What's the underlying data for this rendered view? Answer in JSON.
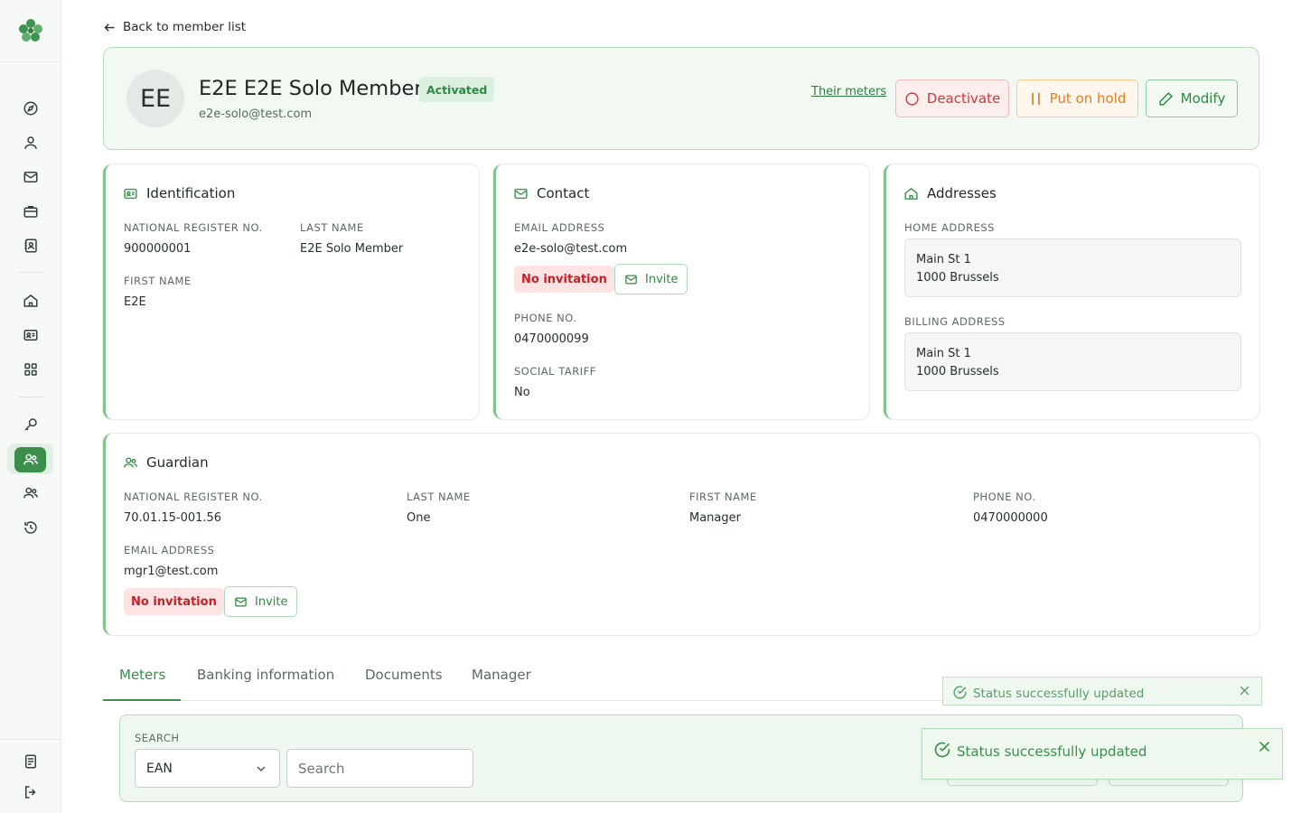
{
  "navigation": {
    "back_label": "Back to member list"
  },
  "member": {
    "initials": "EE",
    "name": "E2E E2E Solo Member",
    "status_badge": "Activated",
    "email": "e2e-solo@test.com"
  },
  "header_actions": {
    "their_meters": "Their meters",
    "deactivate": "Deactivate",
    "put_on_hold": "Put on hold",
    "modify": "Modify"
  },
  "identification": {
    "title": "Identification",
    "national_register_label": "NATIONAL REGISTER NO.",
    "national_register_value": "900000001",
    "last_name_label": "LAST NAME",
    "last_name_value": "E2E Solo Member",
    "first_name_label": "FIRST NAME",
    "first_name_value": "E2E"
  },
  "contact": {
    "title": "Contact",
    "email_label": "EMAIL ADDRESS",
    "email_value": "e2e-solo@test.com",
    "invitation_status": "No invitation",
    "invite_button": "Invite",
    "phone_label": "PHONE NO.",
    "phone_value": "0470000099",
    "social_tariff_label": "SOCIAL TARIFF",
    "social_tariff_value": "No"
  },
  "addresses": {
    "title": "Addresses",
    "home_label": "HOME ADDRESS",
    "home_line1": "Main St 1",
    "home_line2": "1000 Brussels",
    "billing_label": "BILLING ADDRESS",
    "billing_line1": "Main St 1",
    "billing_line2": "1000 Brussels"
  },
  "guardian": {
    "title": "Guardian",
    "national_register_label": "NATIONAL REGISTER NO.",
    "national_register_value": "70.01.15-001.56",
    "last_name_label": "LAST NAME",
    "last_name_value": "One",
    "first_name_label": "FIRST NAME",
    "first_name_value": "Manager",
    "phone_label": "PHONE NO.",
    "phone_value": "0470000000",
    "email_label": "EMAIL ADDRESS",
    "email_value": "mgr1@test.com",
    "invitation_status": "No invitation",
    "invite_button": "Invite"
  },
  "tabs": {
    "items": [
      {
        "label": "Meters",
        "active": true
      },
      {
        "label": "Banking information",
        "active": false
      },
      {
        "label": "Documents",
        "active": false
      },
      {
        "label": "Manager",
        "active": false
      }
    ]
  },
  "search": {
    "label": "SEARCH",
    "field_selected": "EAN",
    "placeholder": "Search"
  },
  "toasts": [
    {
      "message": "Status successfully updated"
    },
    {
      "message": "Status successfully updated"
    }
  ],
  "sidebar": {
    "icons": [
      "compass-icon",
      "user-icon",
      "mail-icon",
      "briefcase-icon",
      "contact-book-icon",
      "home-icon",
      "id-card-icon",
      "grid-icon",
      "key-icon",
      "members-icon",
      "group-icon",
      "history-icon",
      "document-icon",
      "logout-icon"
    ]
  },
  "colors": {
    "accent": "#3a8f4a",
    "danger": "#d2373b",
    "warning": "#e3801f",
    "header_bg": "#f1f9f2"
  }
}
